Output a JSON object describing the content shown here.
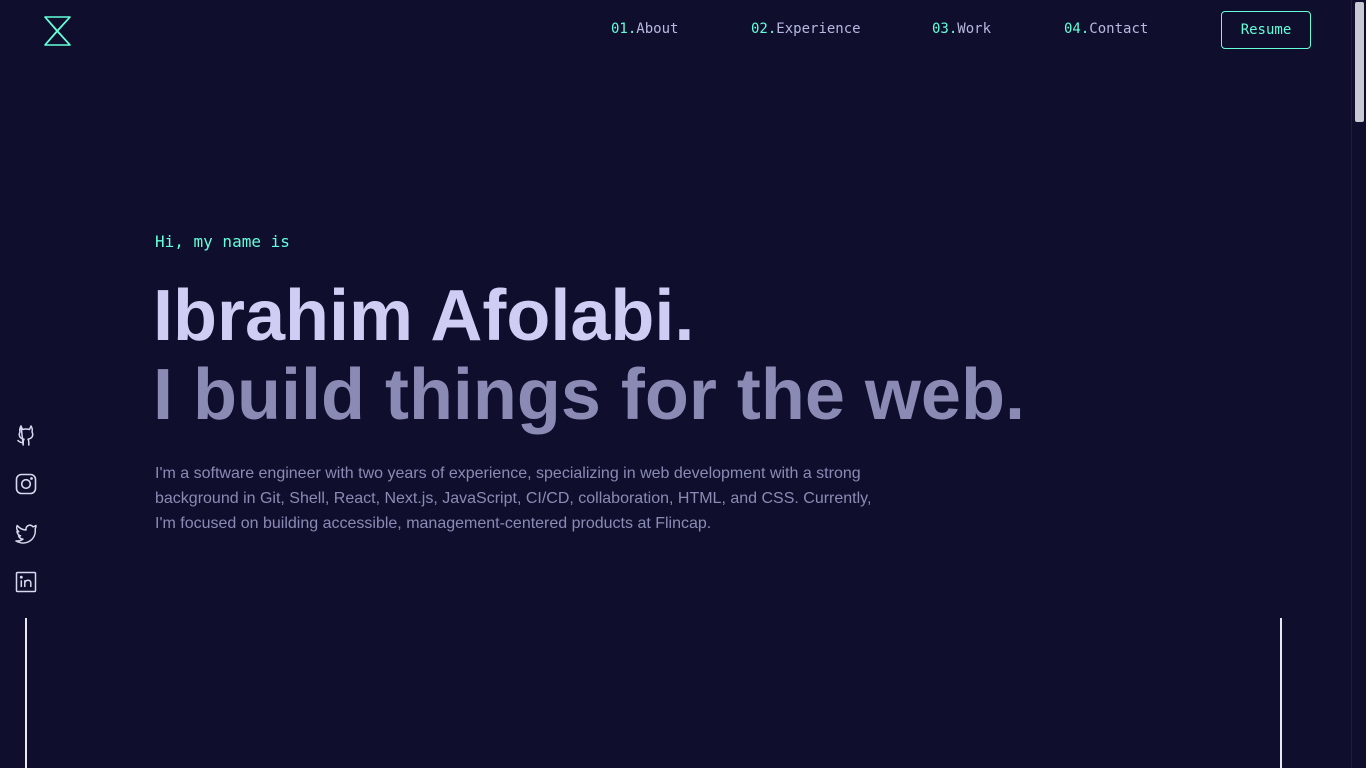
{
  "header": {
    "logo_icon": "logo-icon",
    "nav": [
      {
        "num": "01.",
        "label": "About"
      },
      {
        "num": "02.",
        "label": "Experience"
      },
      {
        "num": "03.",
        "label": "Work"
      },
      {
        "num": "04.",
        "label": "Contact"
      }
    ],
    "resume_label": "Resume"
  },
  "hero": {
    "greeting": "Hi, my name is",
    "name": "Ibrahim Afolabi.",
    "tagline": "I build things for the web.",
    "bio": "I'm a software engineer with two years of experience, specializing in web development with a strong background in Git, Shell, React, Next.js, JavaScript, CI/CD, collaboration, HTML, and CSS. Currently, I'm focused on building accessible, management-centered products at Flincap."
  },
  "socials": [
    {
      "icon": "github-icon"
    },
    {
      "icon": "instagram-icon"
    },
    {
      "icon": "twitter-icon"
    },
    {
      "icon": "linkedin-icon"
    }
  ],
  "colors": {
    "background": "#0f0f2d",
    "accent": "#64ffda",
    "heading": "#d0cdf5",
    "muted": "#8b8ab5"
  }
}
